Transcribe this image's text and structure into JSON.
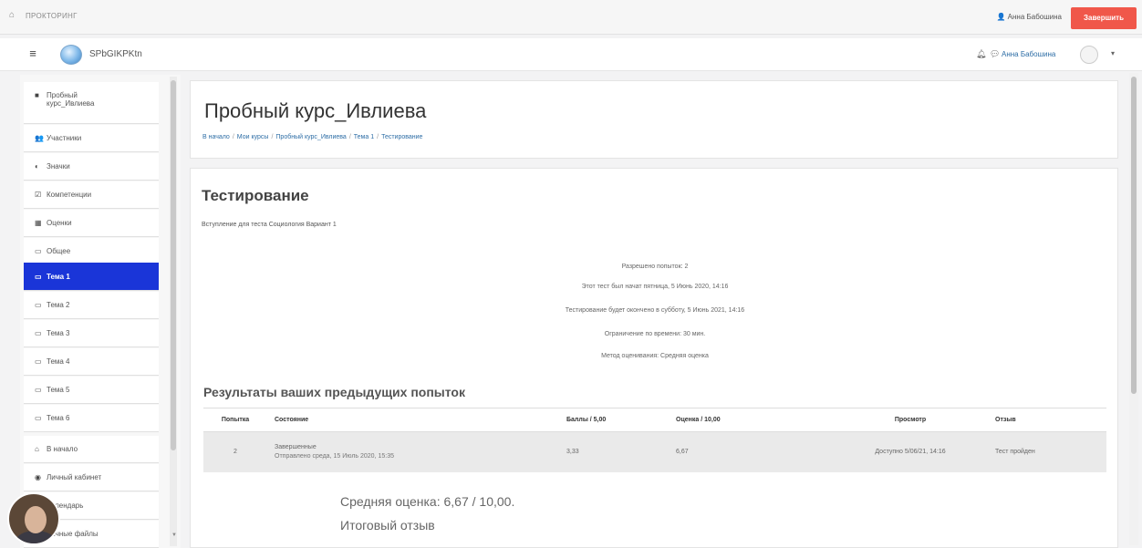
{
  "topbar": {
    "home_icon": "home-icon",
    "crumb": "ПРОКТОРИНГ",
    "user": "Анна Бабошина",
    "end_button": "Завершить"
  },
  "navbar": {
    "menu_icon": "hamburger-icon",
    "site_name": "SPbGIKPKtn",
    "user_name": "Анна Бабошина"
  },
  "sidebar": {
    "items": [
      {
        "label": "Пробный",
        "label2": "курс_Ивлиева",
        "icon": "■"
      },
      {
        "label": "Участники",
        "icon": "👥"
      },
      {
        "label": "Значки",
        "icon": "◐"
      },
      {
        "label": "Компетенции",
        "icon": "☑"
      },
      {
        "label": "Оценки",
        "icon": "▦"
      },
      {
        "label": "Общее",
        "icon": "▭"
      },
      {
        "label": "Тема 1",
        "icon": "▭",
        "active": true
      },
      {
        "label": "Тема 2",
        "icon": "▭"
      },
      {
        "label": "Тема 3",
        "icon": "▭"
      },
      {
        "label": "Тема 4",
        "icon": "▭"
      },
      {
        "label": "Тема 5",
        "icon": "▭"
      },
      {
        "label": "Тема 6",
        "icon": "▭"
      },
      {
        "label": "В начало",
        "icon": "⌂"
      },
      {
        "label": "Личный кабинет",
        "icon": "◉"
      },
      {
        "label": "Календарь",
        "icon": "▤"
      },
      {
        "label": "Личные файлы",
        "icon": "▭"
      }
    ]
  },
  "header": {
    "title": "Пробный курс_Ивлиева",
    "breadcrumb": [
      "В начало",
      "Мои курсы",
      "Пробный курс_Ивлиева",
      "Тема 1",
      "Тестирование"
    ]
  },
  "main": {
    "section_title": "Тестирование",
    "intro": "Вступление для теста Социология Вариант 1",
    "info": [
      "Разрешено попыток: 2",
      "Этот тест был начат пятница, 5 Июнь 2020, 14:16",
      "Тестирование будет окончено в субботу, 5 Июнь 2021, 14:16",
      "Ограничение по времени: 30 мин.",
      "Метод оценивания: Средняя оценка"
    ],
    "prev_title": "Результаты ваших предыдущих попыток",
    "table": {
      "headers": [
        "Попытка",
        "Состояние",
        "Баллы / 5,00",
        "Оценка / 10,00",
        "Просмотр",
        "Отзыв"
      ],
      "rows": [
        {
          "attempt": "2",
          "state": "Завершенные",
          "state_sub": "Отправлено среда, 15 Июль 2020, 15:35",
          "points": "3,33",
          "grade": "6,67",
          "review": "Доступно 5/06/21, 14:16",
          "feedback": "Тест пройден"
        }
      ]
    },
    "average": "Средняя оценка: 6,67 / 10,00.",
    "final_feedback": "Итоговый отзыв"
  },
  "colors": {
    "accent": "#1a35d8",
    "end_button": "#f0574a",
    "link": "#2e6ea6"
  }
}
